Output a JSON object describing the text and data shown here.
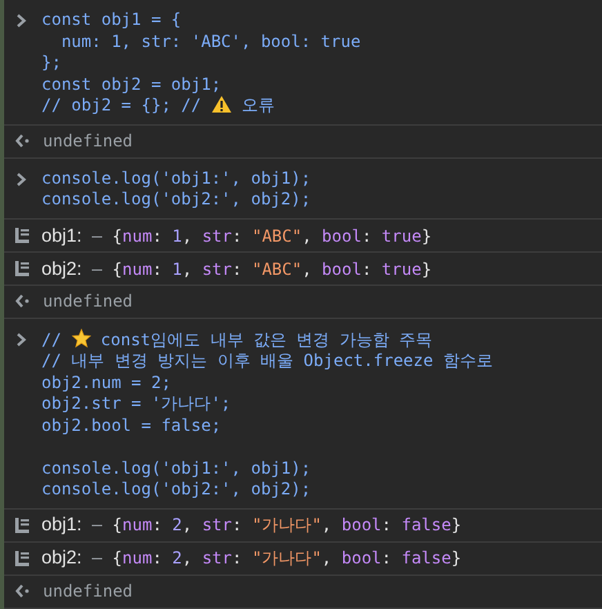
{
  "entries": [
    {
      "kind": "input",
      "lines": [
        {
          "kind": "code",
          "text": "const obj1 = {"
        },
        {
          "kind": "code",
          "text": "  num: 1, str: 'ABC', bool: true"
        },
        {
          "kind": "code",
          "text": "};"
        },
        {
          "kind": "code",
          "text": "const obj2 = obj1;"
        },
        {
          "kind": "warning",
          "text": "// obj2 = {}; //",
          "after": "오류"
        }
      ]
    },
    {
      "kind": "result",
      "text": "undefined"
    },
    {
      "kind": "input",
      "lines": [
        {
          "kind": "code",
          "text": "console.log('obj1:', obj1);"
        },
        {
          "kind": "code",
          "text": "console.log('obj2:', obj2);"
        }
      ]
    },
    {
      "kind": "log",
      "tokens": [
        {
          "kind": "label",
          "text": "obj1:"
        },
        {
          "kind": "dash",
          "text": "–"
        },
        {
          "kind": "punct",
          "text": "{"
        },
        {
          "kind": "key",
          "text": "num"
        },
        {
          "kind": "punct",
          "text": ": "
        },
        {
          "kind": "number",
          "text": "1"
        },
        {
          "kind": "punct",
          "text": ", "
        },
        {
          "kind": "key",
          "text": "str"
        },
        {
          "kind": "punct",
          "text": ": "
        },
        {
          "kind": "string",
          "text": "\"ABC\""
        },
        {
          "kind": "punct",
          "text": ", "
        },
        {
          "kind": "key",
          "text": "bool"
        },
        {
          "kind": "punct",
          "text": ": "
        },
        {
          "kind": "boolean",
          "text": "true"
        },
        {
          "kind": "punct",
          "text": "}"
        }
      ]
    },
    {
      "kind": "log",
      "tokens": [
        {
          "kind": "label",
          "text": "obj2:"
        },
        {
          "kind": "dash",
          "text": "–"
        },
        {
          "kind": "punct",
          "text": "{"
        },
        {
          "kind": "key",
          "text": "num"
        },
        {
          "kind": "punct",
          "text": ": "
        },
        {
          "kind": "number",
          "text": "1"
        },
        {
          "kind": "punct",
          "text": ", "
        },
        {
          "kind": "key",
          "text": "str"
        },
        {
          "kind": "punct",
          "text": ": "
        },
        {
          "kind": "string",
          "text": "\"ABC\""
        },
        {
          "kind": "punct",
          "text": ", "
        },
        {
          "kind": "key",
          "text": "bool"
        },
        {
          "kind": "punct",
          "text": ": "
        },
        {
          "kind": "boolean",
          "text": "true"
        },
        {
          "kind": "punct",
          "text": "}"
        }
      ]
    },
    {
      "kind": "result",
      "text": "undefined"
    },
    {
      "kind": "input",
      "lines": [
        {
          "kind": "star",
          "text": "//",
          "after": "const임에도 내부 값은 변경 가능함 주목"
        },
        {
          "kind": "code",
          "text": "// 내부 변경 방지는 이후 배울 Object.freeze 함수로"
        },
        {
          "kind": "code",
          "text": "obj2.num = 2;"
        },
        {
          "kind": "code",
          "text": "obj2.str = '가나다';"
        },
        {
          "kind": "code",
          "text": "obj2.bool = false;"
        },
        {
          "kind": "blank"
        },
        {
          "kind": "code",
          "text": "console.log('obj1:', obj1);"
        },
        {
          "kind": "code",
          "text": "console.log('obj2:', obj2);"
        }
      ]
    },
    {
      "kind": "log",
      "tokens": [
        {
          "kind": "label",
          "text": "obj1:"
        },
        {
          "kind": "dash",
          "text": "–"
        },
        {
          "kind": "punct",
          "text": "{"
        },
        {
          "kind": "key",
          "text": "num"
        },
        {
          "kind": "punct",
          "text": ": "
        },
        {
          "kind": "number",
          "text": "2"
        },
        {
          "kind": "punct",
          "text": ", "
        },
        {
          "kind": "key",
          "text": "str"
        },
        {
          "kind": "punct",
          "text": ": "
        },
        {
          "kind": "string",
          "text": "\"가나다\""
        },
        {
          "kind": "punct",
          "text": ", "
        },
        {
          "kind": "key",
          "text": "bool"
        },
        {
          "kind": "punct",
          "text": ": "
        },
        {
          "kind": "boolean",
          "text": "false"
        },
        {
          "kind": "punct",
          "text": "}"
        }
      ]
    },
    {
      "kind": "log",
      "tokens": [
        {
          "kind": "label",
          "text": "obj2:"
        },
        {
          "kind": "dash",
          "text": "–"
        },
        {
          "kind": "punct",
          "text": "{"
        },
        {
          "kind": "key",
          "text": "num"
        },
        {
          "kind": "punct",
          "text": ": "
        },
        {
          "kind": "number",
          "text": "2"
        },
        {
          "kind": "punct",
          "text": ", "
        },
        {
          "kind": "key",
          "text": "str"
        },
        {
          "kind": "punct",
          "text": ": "
        },
        {
          "kind": "string",
          "text": "\"가나다\""
        },
        {
          "kind": "punct",
          "text": ", "
        },
        {
          "kind": "key",
          "text": "bool"
        },
        {
          "kind": "punct",
          "text": ": "
        },
        {
          "kind": "boolean",
          "text": "false"
        },
        {
          "kind": "punct",
          "text": "}"
        }
      ]
    },
    {
      "kind": "result",
      "text": "undefined"
    }
  ]
}
